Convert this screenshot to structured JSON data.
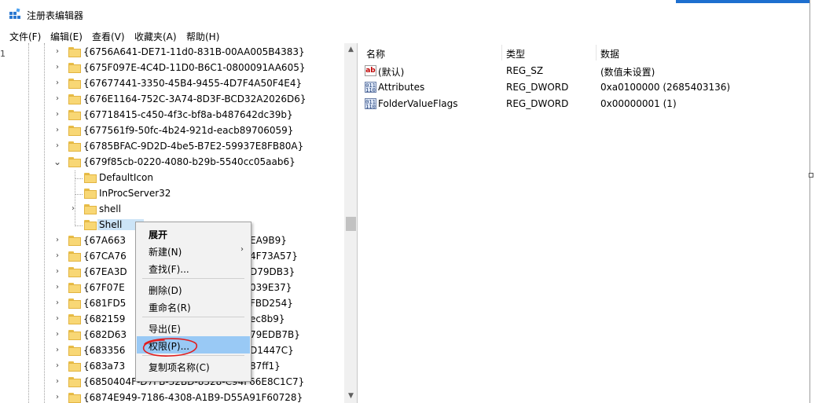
{
  "window": {
    "title": "注册表编辑器",
    "left_gutter_text": "1"
  },
  "menu": [
    {
      "label": "文件(F)"
    },
    {
      "label": "编辑(E)"
    },
    {
      "label": "查看(V)"
    },
    {
      "label": "收藏夹(A)"
    },
    {
      "label": "帮助(H)"
    }
  ],
  "tree": {
    "rows": [
      {
        "label": "{6756A641-DE71-11d0-831B-00AA005B4383}",
        "expander": "collapsed"
      },
      {
        "label": "{675F097E-4C4D-11D0-B6C1-0800091AA605}",
        "expander": "collapsed"
      },
      {
        "label": "{67677441-3350-45B4-9455-4D7F4A50F4E4}",
        "expander": "collapsed"
      },
      {
        "label": "{676E1164-752C-3A74-8D3F-BCD32A2026D6}",
        "expander": "collapsed"
      },
      {
        "label": "{67718415-c450-4f3c-bf8a-b487642dc39b}",
        "expander": "collapsed"
      },
      {
        "label": "{677561f9-50fc-4b24-921d-eacb89706059}",
        "expander": "collapsed"
      },
      {
        "label": "{6785BFAC-9D2D-4be5-B7E2-59937E8FB80A}",
        "expander": "collapsed"
      },
      {
        "label": "{679f85cb-0220-4080-b29b-5540cc05aab6}",
        "expander": "expanded"
      },
      {
        "label": "DefaultIcon",
        "expander": "none",
        "child": true
      },
      {
        "label": "InProcServer32",
        "expander": "none",
        "child": true
      },
      {
        "label": "shell",
        "expander": "collapsed",
        "child": true
      },
      {
        "label": "Shell",
        "expander": "none",
        "child": true,
        "selected": true
      },
      {
        "label": "{67A663",
        "tail": "EA9B9}",
        "expander": "collapsed"
      },
      {
        "label": "{67CA76",
        "tail": "4F73A57}",
        "expander": "collapsed"
      },
      {
        "label": "{67EA3D",
        "tail": "D79DB3}",
        "expander": "collapsed"
      },
      {
        "label": "{67F07E",
        "tail": "039E37}",
        "expander": "collapsed"
      },
      {
        "label": "{681FD5",
        "tail": "FBD254}",
        "expander": "collapsed"
      },
      {
        "label": "{682159",
        "tail": "ec8b9}",
        "expander": "collapsed"
      },
      {
        "label": "{682D63",
        "tail": "79EDB7B}",
        "expander": "collapsed"
      },
      {
        "label": "{683356",
        "tail": "D1447C}",
        "expander": "collapsed"
      },
      {
        "label": "{683a73",
        "tail": "87ff1}",
        "expander": "collapsed"
      },
      {
        "label": "{6850404F-D7FB-32BD-8328-C94F66E8C1C7}",
        "expander": "collapsed"
      },
      {
        "label": "{6874E949-7186-4308-A1B9-D55A91F60728}",
        "expander": "collapsed"
      }
    ]
  },
  "list": {
    "headers": {
      "name": "名称",
      "type": "类型",
      "data": "数据"
    },
    "rows": [
      {
        "icon": "string-value-icon",
        "icon_text": "ab",
        "name": "(默认)",
        "type": "REG_SZ",
        "data": "(数值未设置)"
      },
      {
        "icon": "binary-value-icon",
        "icon_text": "011 110",
        "name": "Attributes",
        "type": "REG_DWORD",
        "data": "0xa0100000 (2685403136)"
      },
      {
        "icon": "binary-value-icon",
        "icon_text": "011 110",
        "name": "FolderValueFlags",
        "type": "REG_DWORD",
        "data": "0x00000001 (1)"
      }
    ]
  },
  "context_menu": {
    "items": [
      {
        "label": "展开",
        "bold": true
      },
      {
        "label": "新建(N)",
        "submenu": true,
        "arrow": "›"
      },
      {
        "label": "查找(F)..."
      },
      {
        "separator": true
      },
      {
        "label": "删除(D)"
      },
      {
        "label": "重命名(R)"
      },
      {
        "separator": true
      },
      {
        "label": "导出(E)"
      },
      {
        "label": "权限(P)...",
        "highlighted": true
      },
      {
        "separator": true
      },
      {
        "label": "复制项名称(C)"
      }
    ]
  },
  "colors": {
    "highlight": "#99c9f5",
    "annotation": "#e11d1d",
    "folder": "#f8d775"
  }
}
